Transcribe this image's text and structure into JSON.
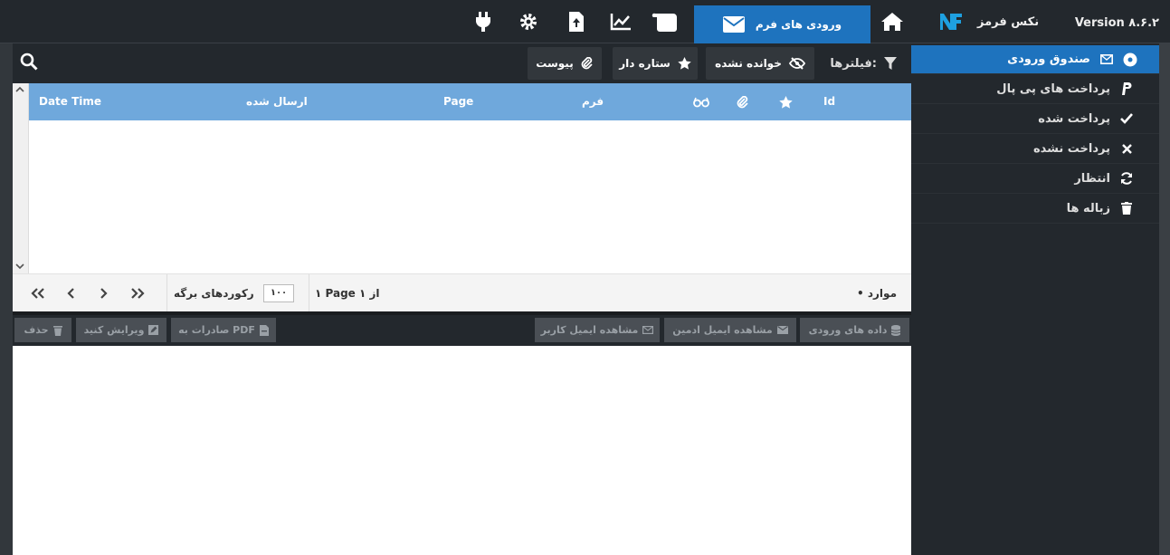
{
  "topbar": {
    "version": "Version ۸.۶.۲",
    "brand_name": "نکس فرمز",
    "active_tab_label": "ورودی های فرم",
    "icons": [
      "plug-icon",
      "gear-icon",
      "file-upload-icon",
      "chart-line-icon",
      "scroll-icon",
      "home-icon",
      "envelope-icon"
    ]
  },
  "sidebar": {
    "items": [
      {
        "label": "صندوق ورودی",
        "icon": "envelope-icon",
        "active": true
      },
      {
        "label": "پرداخت های پی پال",
        "icon": "paypal-icon"
      },
      {
        "label": "پرداخت شده",
        "icon": "check-icon"
      },
      {
        "label": "پرداخت نشده",
        "icon": "times-icon"
      },
      {
        "label": "انتظار",
        "icon": "refresh-icon"
      },
      {
        "label": "زباله ها",
        "icon": "trash-icon"
      }
    ]
  },
  "filters": {
    "label": "فیلترها:",
    "unread": "خوانده نشده",
    "starred": "ستاره دار",
    "attachment": "پیوست"
  },
  "table": {
    "columns": {
      "id": "Id",
      "form": "فرم",
      "page": "Page",
      "sent": "ارسال شده",
      "datetime": "Date Time"
    }
  },
  "pager": {
    "items": "• موارد",
    "page_info": "۱ Page از ۱",
    "per_page_label": "رکوردهای برگه",
    "per_page_value": "۱۰۰"
  },
  "actions": {
    "entry_data": "داده های ورودی",
    "admin_email": "مشاهده ایمیل ادمین",
    "user_email": "مشاهده ایمیل کاربر",
    "export_pdf": "صادرات به PDF",
    "edit": "ویرایش کنید",
    "delete": "حذف"
  },
  "colors": {
    "accent": "#1e73be",
    "header": "#6fa8dc",
    "dark": "#23282d"
  }
}
